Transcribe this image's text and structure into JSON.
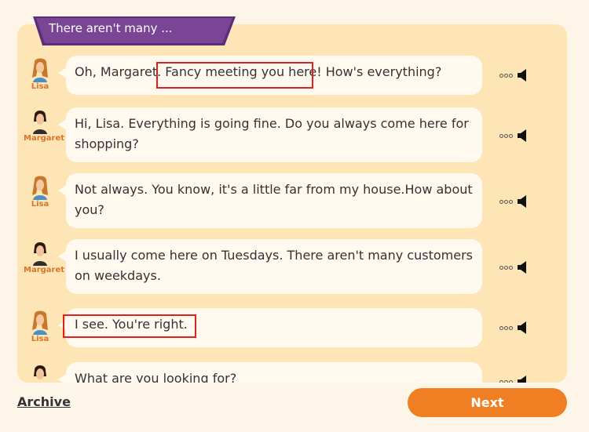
{
  "title": "There aren't many ...",
  "messages": [
    {
      "speaker": "Lisa",
      "text": "Oh, Margaret. Fancy meeting you here! How's everything?"
    },
    {
      "speaker": "Margaret",
      "text": "Hi, Lisa. Everything is going fine. Do you always come here for shopping?"
    },
    {
      "speaker": "Lisa",
      "text": "Not always. You know, it's a little far from my house.How about you?"
    },
    {
      "speaker": "Margaret",
      "text": "I usually come here on Tuesdays. There aren't many customers on weekdays."
    },
    {
      "speaker": "Lisa",
      "text": "I see. You're right."
    },
    {
      "speaker": "Margaret",
      "text": "What are you looking for?"
    }
  ],
  "footer": {
    "archive_label": "Archive",
    "next_label": "Next"
  },
  "colors": {
    "panel": "#fde5b6",
    "bubble": "#fff9ef",
    "accent": "#ef7f22",
    "title_tab": "#5b2d7a",
    "highlight": "#e02020",
    "speaker_name": "#d9742a"
  },
  "icons": [
    "lisa-avatar-icon",
    "margaret-avatar-icon",
    "more-dots-icon",
    "speaker-icon"
  ]
}
